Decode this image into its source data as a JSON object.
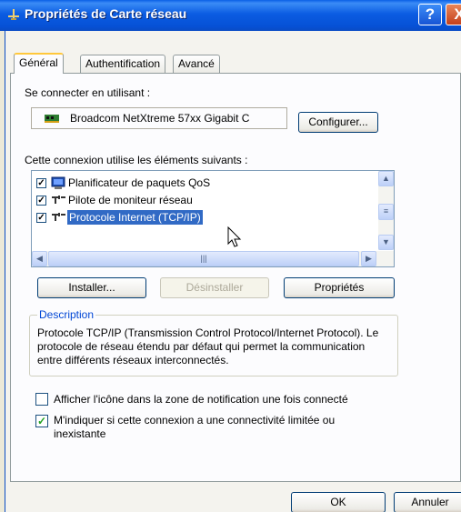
{
  "window": {
    "title": "Propriétés de Carte réseau",
    "help_label": "?",
    "close_label": "X"
  },
  "tabs": [
    {
      "label": "Général",
      "active": true
    },
    {
      "label": "Authentification",
      "active": false
    },
    {
      "label": "Avancé",
      "active": false
    }
  ],
  "connect_using": {
    "label": "Se connecter en utilisant :",
    "adapter": "Broadcom NetXtreme 57xx Gigabit C",
    "configure_label": "Configurer..."
  },
  "components": {
    "label": "Cette connexion utilise les éléments suivants :",
    "items": [
      {
        "label": "Planificateur de paquets QoS",
        "checked": true,
        "icon": "qos-icon"
      },
      {
        "label": "Pilote de moniteur réseau",
        "checked": true,
        "icon": "network-cable-icon"
      },
      {
        "label": "Protocole Internet (TCP/IP)",
        "checked": true,
        "selected": true,
        "icon": "network-cable-icon"
      }
    ]
  },
  "buttons": {
    "install": "Installer...",
    "uninstall": "Désinstaller",
    "properties": "Propriétés",
    "ok": "OK",
    "cancel": "Annuler"
  },
  "description": {
    "title": "Description",
    "text": "Protocole TCP/IP (Transmission Control Protocol/Internet Protocol). Le protocole de réseau étendu par défaut qui permet la communication entre différents réseaux interconnectés."
  },
  "options": {
    "show_icon": {
      "label": "Afficher l'icône dans la zone de notification une fois connecté",
      "checked": false
    },
    "notify_limited": {
      "label": "M'indiquer si cette connexion a une connectivité limitée ou inexistante",
      "checked": true
    }
  },
  "colors": {
    "titlebar": "#0a5fe6",
    "selection": "#316ac5",
    "group_title": "#0046d5"
  }
}
